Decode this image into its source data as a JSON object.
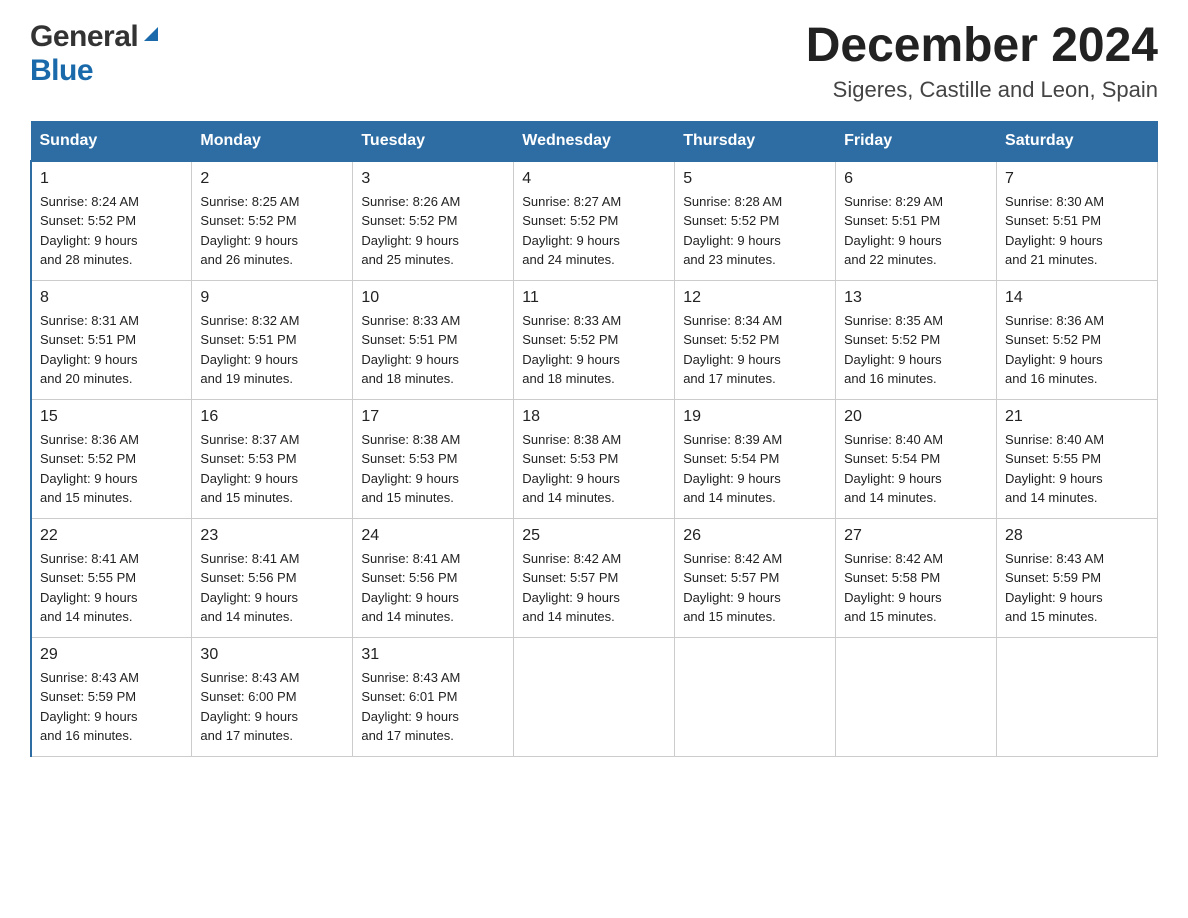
{
  "header": {
    "logo_general": "General",
    "logo_blue": "Blue",
    "month_title": "December 2024",
    "location": "Sigeres, Castille and Leon, Spain"
  },
  "weekdays": [
    "Sunday",
    "Monday",
    "Tuesday",
    "Wednesday",
    "Thursday",
    "Friday",
    "Saturday"
  ],
  "weeks": [
    [
      {
        "day": "1",
        "sunrise": "Sunrise: 8:24 AM",
        "sunset": "Sunset: 5:52 PM",
        "daylight": "Daylight: 9 hours",
        "minutes": "and 28 minutes."
      },
      {
        "day": "2",
        "sunrise": "Sunrise: 8:25 AM",
        "sunset": "Sunset: 5:52 PM",
        "daylight": "Daylight: 9 hours",
        "minutes": "and 26 minutes."
      },
      {
        "day": "3",
        "sunrise": "Sunrise: 8:26 AM",
        "sunset": "Sunset: 5:52 PM",
        "daylight": "Daylight: 9 hours",
        "minutes": "and 25 minutes."
      },
      {
        "day": "4",
        "sunrise": "Sunrise: 8:27 AM",
        "sunset": "Sunset: 5:52 PM",
        "daylight": "Daylight: 9 hours",
        "minutes": "and 24 minutes."
      },
      {
        "day": "5",
        "sunrise": "Sunrise: 8:28 AM",
        "sunset": "Sunset: 5:52 PM",
        "daylight": "Daylight: 9 hours",
        "minutes": "and 23 minutes."
      },
      {
        "day": "6",
        "sunrise": "Sunrise: 8:29 AM",
        "sunset": "Sunset: 5:51 PM",
        "daylight": "Daylight: 9 hours",
        "minutes": "and 22 minutes."
      },
      {
        "day": "7",
        "sunrise": "Sunrise: 8:30 AM",
        "sunset": "Sunset: 5:51 PM",
        "daylight": "Daylight: 9 hours",
        "minutes": "and 21 minutes."
      }
    ],
    [
      {
        "day": "8",
        "sunrise": "Sunrise: 8:31 AM",
        "sunset": "Sunset: 5:51 PM",
        "daylight": "Daylight: 9 hours",
        "minutes": "and 20 minutes."
      },
      {
        "day": "9",
        "sunrise": "Sunrise: 8:32 AM",
        "sunset": "Sunset: 5:51 PM",
        "daylight": "Daylight: 9 hours",
        "minutes": "and 19 minutes."
      },
      {
        "day": "10",
        "sunrise": "Sunrise: 8:33 AM",
        "sunset": "Sunset: 5:51 PM",
        "daylight": "Daylight: 9 hours",
        "minutes": "and 18 minutes."
      },
      {
        "day": "11",
        "sunrise": "Sunrise: 8:33 AM",
        "sunset": "Sunset: 5:52 PM",
        "daylight": "Daylight: 9 hours",
        "minutes": "and 18 minutes."
      },
      {
        "day": "12",
        "sunrise": "Sunrise: 8:34 AM",
        "sunset": "Sunset: 5:52 PM",
        "daylight": "Daylight: 9 hours",
        "minutes": "and 17 minutes."
      },
      {
        "day": "13",
        "sunrise": "Sunrise: 8:35 AM",
        "sunset": "Sunset: 5:52 PM",
        "daylight": "Daylight: 9 hours",
        "minutes": "and 16 minutes."
      },
      {
        "day": "14",
        "sunrise": "Sunrise: 8:36 AM",
        "sunset": "Sunset: 5:52 PM",
        "daylight": "Daylight: 9 hours",
        "minutes": "and 16 minutes."
      }
    ],
    [
      {
        "day": "15",
        "sunrise": "Sunrise: 8:36 AM",
        "sunset": "Sunset: 5:52 PM",
        "daylight": "Daylight: 9 hours",
        "minutes": "and 15 minutes."
      },
      {
        "day": "16",
        "sunrise": "Sunrise: 8:37 AM",
        "sunset": "Sunset: 5:53 PM",
        "daylight": "Daylight: 9 hours",
        "minutes": "and 15 minutes."
      },
      {
        "day": "17",
        "sunrise": "Sunrise: 8:38 AM",
        "sunset": "Sunset: 5:53 PM",
        "daylight": "Daylight: 9 hours",
        "minutes": "and 15 minutes."
      },
      {
        "day": "18",
        "sunrise": "Sunrise: 8:38 AM",
        "sunset": "Sunset: 5:53 PM",
        "daylight": "Daylight: 9 hours",
        "minutes": "and 14 minutes."
      },
      {
        "day": "19",
        "sunrise": "Sunrise: 8:39 AM",
        "sunset": "Sunset: 5:54 PM",
        "daylight": "Daylight: 9 hours",
        "minutes": "and 14 minutes."
      },
      {
        "day": "20",
        "sunrise": "Sunrise: 8:40 AM",
        "sunset": "Sunset: 5:54 PM",
        "daylight": "Daylight: 9 hours",
        "minutes": "and 14 minutes."
      },
      {
        "day": "21",
        "sunrise": "Sunrise: 8:40 AM",
        "sunset": "Sunset: 5:55 PM",
        "daylight": "Daylight: 9 hours",
        "minutes": "and 14 minutes."
      }
    ],
    [
      {
        "day": "22",
        "sunrise": "Sunrise: 8:41 AM",
        "sunset": "Sunset: 5:55 PM",
        "daylight": "Daylight: 9 hours",
        "minutes": "and 14 minutes."
      },
      {
        "day": "23",
        "sunrise": "Sunrise: 8:41 AM",
        "sunset": "Sunset: 5:56 PM",
        "daylight": "Daylight: 9 hours",
        "minutes": "and 14 minutes."
      },
      {
        "day": "24",
        "sunrise": "Sunrise: 8:41 AM",
        "sunset": "Sunset: 5:56 PM",
        "daylight": "Daylight: 9 hours",
        "minutes": "and 14 minutes."
      },
      {
        "day": "25",
        "sunrise": "Sunrise: 8:42 AM",
        "sunset": "Sunset: 5:57 PM",
        "daylight": "Daylight: 9 hours",
        "minutes": "and 14 minutes."
      },
      {
        "day": "26",
        "sunrise": "Sunrise: 8:42 AM",
        "sunset": "Sunset: 5:57 PM",
        "daylight": "Daylight: 9 hours",
        "minutes": "and 15 minutes."
      },
      {
        "day": "27",
        "sunrise": "Sunrise: 8:42 AM",
        "sunset": "Sunset: 5:58 PM",
        "daylight": "Daylight: 9 hours",
        "minutes": "and 15 minutes."
      },
      {
        "day": "28",
        "sunrise": "Sunrise: 8:43 AM",
        "sunset": "Sunset: 5:59 PM",
        "daylight": "Daylight: 9 hours",
        "minutes": "and 15 minutes."
      }
    ],
    [
      {
        "day": "29",
        "sunrise": "Sunrise: 8:43 AM",
        "sunset": "Sunset: 5:59 PM",
        "daylight": "Daylight: 9 hours",
        "minutes": "and 16 minutes."
      },
      {
        "day": "30",
        "sunrise": "Sunrise: 8:43 AM",
        "sunset": "Sunset: 6:00 PM",
        "daylight": "Daylight: 9 hours",
        "minutes": "and 17 minutes."
      },
      {
        "day": "31",
        "sunrise": "Sunrise: 8:43 AM",
        "sunset": "Sunset: 6:01 PM",
        "daylight": "Daylight: 9 hours",
        "minutes": "and 17 minutes."
      },
      null,
      null,
      null,
      null
    ]
  ]
}
